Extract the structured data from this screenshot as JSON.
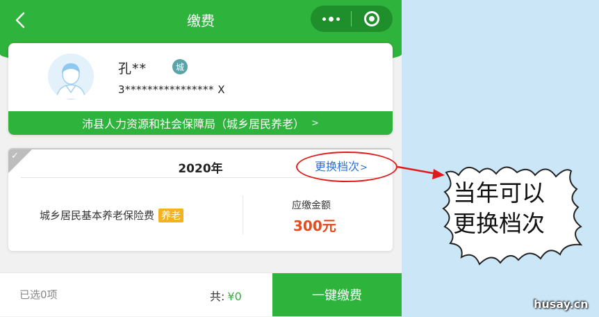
{
  "nav": {
    "title": "缴费",
    "back_icon": "chevron-left-icon",
    "more_icon": "more-dots-icon",
    "close_icon": "target-circle-icon"
  },
  "user": {
    "name": "孔**",
    "badge": "城",
    "id_number": "3**************** X"
  },
  "bureau": {
    "label": "沛县人力资源和社会保障局（城乡居民养老）",
    "arrow": ">"
  },
  "payment": {
    "year": "2020年",
    "change_tier_label": "更换档次",
    "change_tier_arrow": ">",
    "item_name": "城乡居民基本养老保险费",
    "item_tag": "养老",
    "amount_label": "应缴金额",
    "amount_value": "300元"
  },
  "bottom": {
    "selected": "已选0项",
    "total_label": "共:",
    "total_value": "¥0",
    "pay_button": "一键缴费"
  },
  "annotation": {
    "line1": "当年可以",
    "line2": "更换档次"
  },
  "watermark": "husay.cn",
  "colors": {
    "brand_green": "#2eb33c",
    "link_blue": "#2b6fd6",
    "amount_red": "#e8491d",
    "tag_orange": "#f6b21e",
    "annotation_red": "#e01a1a",
    "background_blue": "#cbe6f7"
  }
}
